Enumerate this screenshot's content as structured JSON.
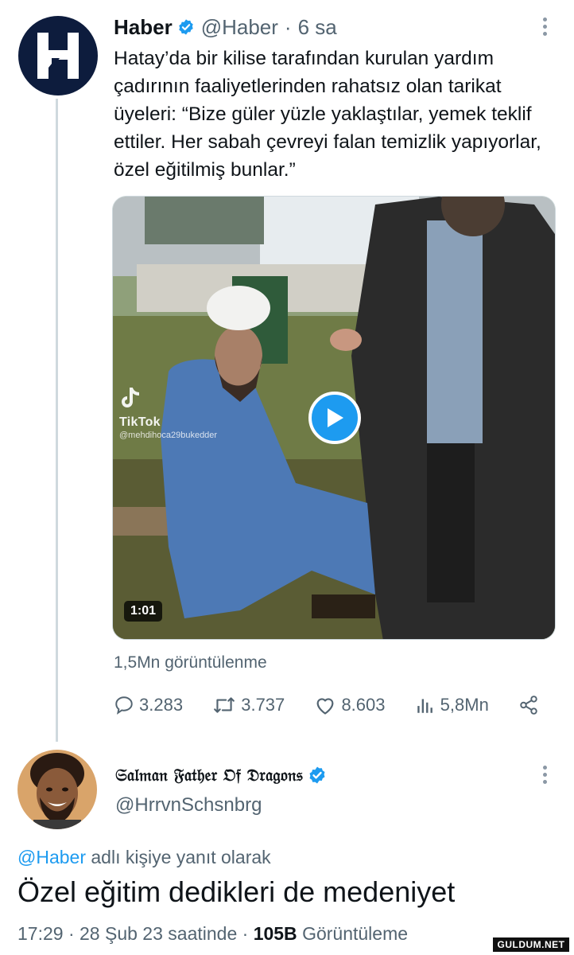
{
  "tweet": {
    "author_name": "Haber",
    "author_handle": "@Haber",
    "separator": "·",
    "time_ago": "6 sa",
    "text": "Hatay’da bir kilise tarafından kurulan yardım çadırının faaliyetlerinden rahatsız olan tarikat üyeleri: “Bize güler yüzle yaklaştılar, yemek teklif ettiler. Her sabah çevreyi falan temizlik yapıyorlar, özel eğitilmiş bunlar.”",
    "avatar_icon": "haber-logo-icon",
    "media": {
      "overlay_brand": "TikTok",
      "overlay_user": "@mehdihoca29bukedder",
      "duration": "1:01",
      "play_icon": "play-icon"
    },
    "views_text": "1,5Mn görüntülenme",
    "actions": {
      "replies": "3.283",
      "retweets": "3.737",
      "likes": "8.603",
      "analytics": "5,8Mn"
    }
  },
  "reply": {
    "author_name": "𝔖𝔞𝔩𝔪𝔞𝔫 𝔉𝔞𝔱𝔥𝔢𝔯 𝔒𝔣 𝔇𝔯𝔞𝔤𝔬𝔫𝔰",
    "author_handle": "@HrrvnSchsnbrg",
    "reply_mention": "@Haber",
    "reply_label": "adlı kişiye yanıt olarak",
    "text": "Özel eğitim dedikleri de medeniyet",
    "time": "17:29",
    "separator": "·",
    "date": "28 Şub 23 saatinde",
    "separator2": "·",
    "view_count": "105B",
    "view_label": "Görüntüleme"
  },
  "watermark": "GULDUM.NET",
  "colors": {
    "accent": "#1d9bf0",
    "muted_text": "#536471",
    "primary_text": "#0f1419",
    "haber_brand": "#0d1c3d"
  }
}
